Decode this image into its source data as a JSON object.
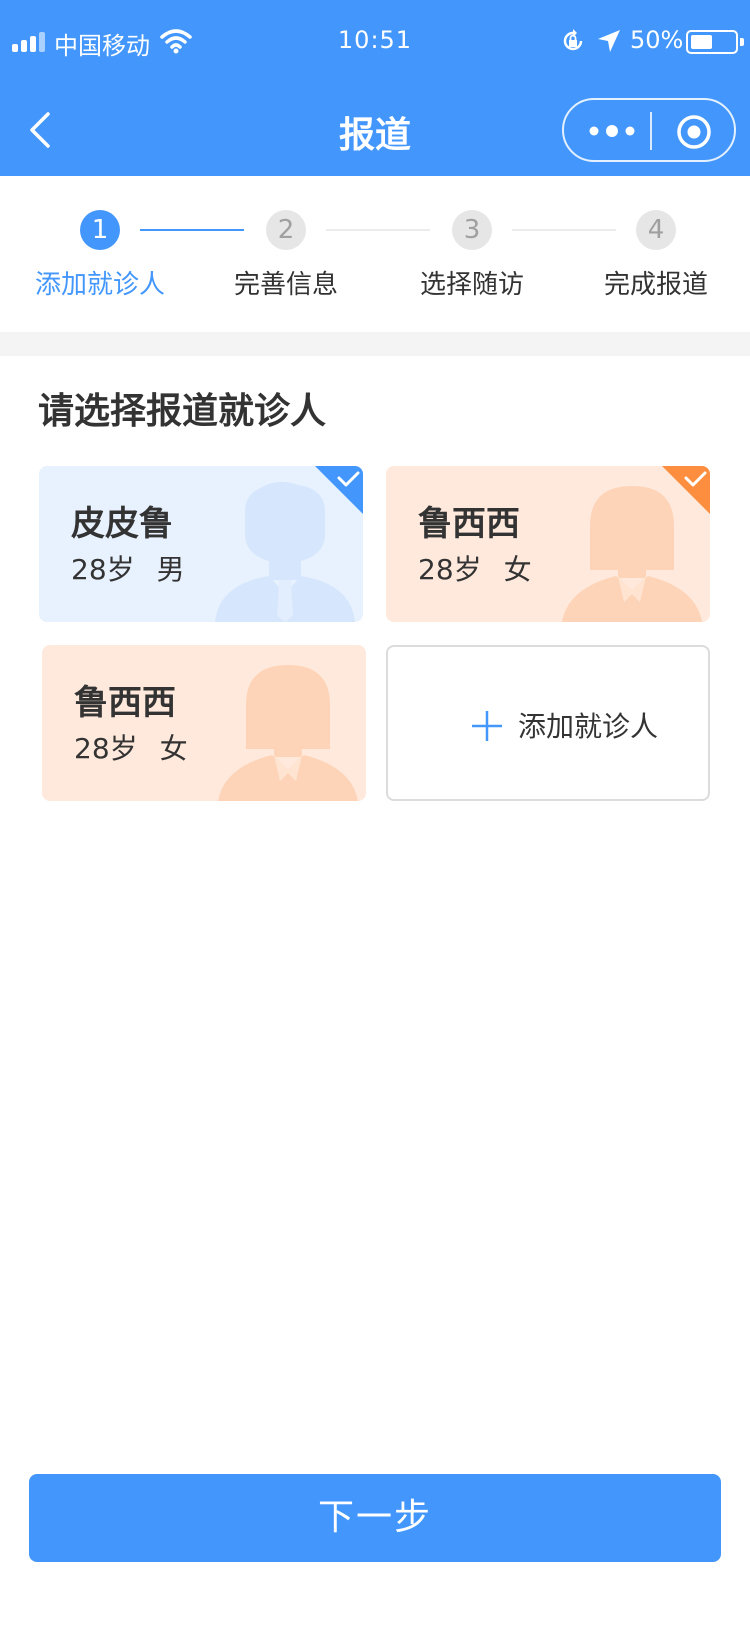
{
  "status_bar": {
    "carrier": "中国移动",
    "time": "10:51",
    "battery": "50%",
    "battery_level": 0.5,
    "icons": [
      "signal-icon",
      "wifi-icon",
      "rotation-lock-icon",
      "location-icon",
      "battery-icon"
    ]
  },
  "nav": {
    "title": "报道",
    "icons": [
      "back-icon",
      "more-icon",
      "close-target-icon"
    ]
  },
  "steps": [
    {
      "number": "1",
      "label": "添加就诊人",
      "active": true
    },
    {
      "number": "2",
      "label": "完善信息",
      "active": false
    },
    {
      "number": "3",
      "label": "选择随访",
      "active": false
    },
    {
      "number": "4",
      "label": "完成报道",
      "active": false
    }
  ],
  "section_title": "请选择报道就诊人",
  "patients": [
    {
      "name": "皮皮鲁",
      "age": "28岁",
      "gender": "男",
      "theme": "blue",
      "selected": true
    },
    {
      "name": "鲁西西",
      "age": "28岁",
      "gender": "女",
      "theme": "orange",
      "selected": true
    },
    {
      "name": "鲁西西",
      "age": "28岁",
      "gender": "女",
      "theme": "orange",
      "selected": false
    }
  ],
  "add_patient_label": "添加就诊人",
  "next_button": "下一步",
  "colors": {
    "primary": "#4397fc",
    "orange_accent": "#fd8e3f",
    "blue_card": "#e8f2fe",
    "orange_card": "#ffe9dc"
  }
}
